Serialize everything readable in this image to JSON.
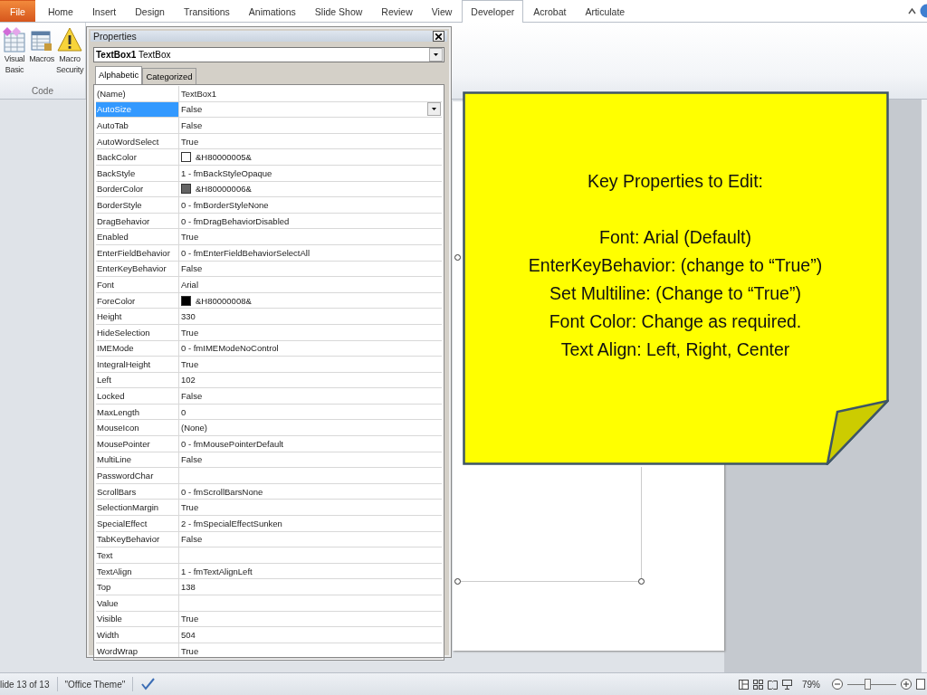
{
  "ribbon": {
    "tabs": [
      {
        "label": "File",
        "kind": "file",
        "selected": false
      },
      {
        "label": "Home",
        "kind": "tab",
        "selected": false
      },
      {
        "label": "Insert",
        "kind": "tab",
        "selected": false
      },
      {
        "label": "Design",
        "kind": "tab",
        "selected": false
      },
      {
        "label": "Transitions",
        "kind": "tab",
        "selected": false
      },
      {
        "label": "Animations",
        "kind": "tab",
        "selected": false
      },
      {
        "label": "Slide Show",
        "kind": "tab",
        "selected": false
      },
      {
        "label": "Review",
        "kind": "tab",
        "selected": false
      },
      {
        "label": "View",
        "kind": "tab",
        "selected": false
      },
      {
        "label": "Developer",
        "kind": "tab",
        "selected": true
      },
      {
        "label": "Acrobat",
        "kind": "tab",
        "selected": false
      },
      {
        "label": "Articulate",
        "kind": "tab",
        "selected": false
      }
    ],
    "group": {
      "label": "Code",
      "buttons": [
        {
          "kind": "vba",
          "lines": [
            "Visual",
            "Basic"
          ]
        },
        {
          "kind": "macros",
          "lines": [
            "Macros"
          ]
        },
        {
          "kind": "security",
          "lines": [
            "Macro",
            "Security"
          ]
        }
      ]
    }
  },
  "properties": {
    "title": "Properties",
    "object": "**TextBox1** TextBox",
    "tabs": [
      {
        "label": "Alphabetic",
        "selected": true
      },
      {
        "label": "Categorized",
        "selected": false
      }
    ],
    "rows": [
      {
        "name": "(Name)",
        "value": "TextBox1",
        "selected": false
      },
      {
        "name": "AutoSize",
        "value": "False",
        "selected": true
      },
      {
        "name": "AutoTab",
        "value": "False",
        "selected": false
      },
      {
        "name": "AutoWordSelect",
        "value": "True",
        "selected": false
      },
      {
        "name": "BackColor",
        "value": "&H80000005&",
        "color": "#ffffff",
        "selected": false
      },
      {
        "name": "BackStyle",
        "value": "1 - fmBackStyleOpaque",
        "selected": false
      },
      {
        "name": "BorderColor",
        "value": "&H80000006&",
        "color": "#646464",
        "selected": false
      },
      {
        "name": "BorderStyle",
        "value": "0 - fmBorderStyleNone",
        "selected": false
      },
      {
        "name": "DragBehavior",
        "value": "0 - fmDragBehaviorDisabled",
        "selected": false
      },
      {
        "name": "Enabled",
        "value": "True",
        "selected": false
      },
      {
        "name": "EnterFieldBehavior",
        "value": "0 - fmEnterFieldBehaviorSelectAll",
        "selected": false
      },
      {
        "name": "EnterKeyBehavior",
        "value": "False",
        "selected": false
      },
      {
        "name": "Font",
        "value": "Arial",
        "selected": false
      },
      {
        "name": "ForeColor",
        "value": "&H80000008&",
        "color": "#000000",
        "selected": false
      },
      {
        "name": "Height",
        "value": "330",
        "selected": false
      },
      {
        "name": "HideSelection",
        "value": "True",
        "selected": false
      },
      {
        "name": "IMEMode",
        "value": "0 - fmIMEModeNoControl",
        "selected": false
      },
      {
        "name": "IntegralHeight",
        "value": "True",
        "selected": false
      },
      {
        "name": "Left",
        "value": "102",
        "selected": false
      },
      {
        "name": "Locked",
        "value": "False",
        "selected": false
      },
      {
        "name": "MaxLength",
        "value": "0",
        "selected": false
      },
      {
        "name": "MouseIcon",
        "value": "(None)",
        "selected": false
      },
      {
        "name": "MousePointer",
        "value": "0 - fmMousePointerDefault",
        "selected": false
      },
      {
        "name": "MultiLine",
        "value": "False",
        "selected": false
      },
      {
        "name": "PasswordChar",
        "selected": false
      },
      {
        "name": "ScrollBars",
        "value": "0 - fmScrollBarsNone",
        "selected": false
      },
      {
        "name": "SelectionMargin",
        "value": "True",
        "selected": false
      },
      {
        "name": "SpecialEffect",
        "value": "2 - fmSpecialEffectSunken",
        "selected": false
      },
      {
        "name": "TabKeyBehavior",
        "value": "False",
        "selected": false
      },
      {
        "name": "Text",
        "selected": false
      },
      {
        "name": "TextAlign",
        "value": "1 - fmTextAlignLeft",
        "selected": false
      },
      {
        "name": "Top",
        "value": "138",
        "selected": false
      },
      {
        "name": "Value",
        "selected": false
      },
      {
        "name": "Visible",
        "value": "True",
        "selected": false
      },
      {
        "name": "Width",
        "value": "504",
        "selected": false
      },
      {
        "name": "WordWrap",
        "value": "True",
        "selected": false
      }
    ]
  },
  "note": {
    "title": "Key Properties to Edit:",
    "lines": [
      "Font: Arial (Default)",
      "EnterKeyBehavior: (change to “True”)",
      "Set Multiline: (Change to “True”)",
      "Font Color: Change as required.",
      "Text Align: Left, Right, Center"
    ]
  },
  "status_bar": {
    "slide": "lide 13 of 13",
    "theme": "\"Office Theme\"",
    "zoom": {
      "reading": "79%",
      "level": 0.4
    }
  }
}
